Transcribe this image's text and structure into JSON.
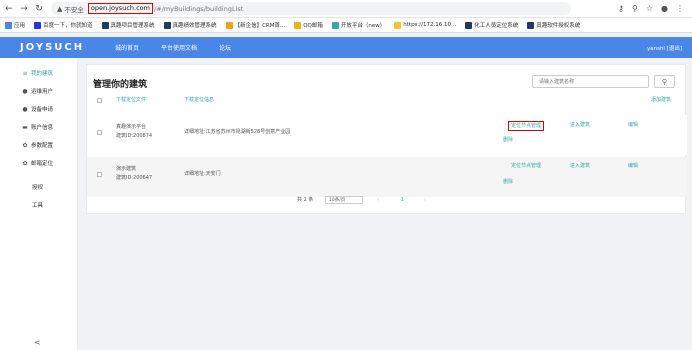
{
  "browser": {
    "insecure_label": "不安全",
    "url_host": "open.joysuch.com",
    "url_path": "/#/myBuildings/buildingList",
    "bookmarks": [
      {
        "label": "应用",
        "color": "#4a86e8"
      },
      {
        "label": "百度一下，你就知道",
        "color": "#2932e1"
      },
      {
        "label": "真趣项目管理系统",
        "color": "#1f3a66"
      },
      {
        "label": "真趣绩效管理系统",
        "color": "#1f3a66"
      },
      {
        "label": "【新企信】CRM首...",
        "color": "#f1a122"
      },
      {
        "label": "QQ邮箱",
        "color": "#e8b21e"
      },
      {
        "label": "开放平台（new）",
        "color": "#3aa6a6"
      },
      {
        "label": "https://172.16.10...",
        "color": "#f3c43b"
      },
      {
        "label": "化工人员定位系统",
        "color": "#1f3a66"
      },
      {
        "label": "真趣软件授权系统",
        "color": "#1f3a66"
      }
    ]
  },
  "header": {
    "logo": "JOYSUCH",
    "nav": [
      "城的首页",
      "平台使用文档",
      "论坛"
    ],
    "user": "yanshi [退出]"
  },
  "sidebar": {
    "items": [
      {
        "label": "我的建筑",
        "icon": "≡",
        "active": true
      },
      {
        "label": "运维用户",
        "icon": "●",
        "active": false
      },
      {
        "label": "设备申请",
        "icon": "●",
        "active": false
      },
      {
        "label": "账户信息",
        "icon": "▬",
        "active": false
      },
      {
        "label": "参数配置",
        "icon": "✿",
        "active": false
      },
      {
        "label": "邮箱定位",
        "icon": "✿",
        "active": false
      }
    ],
    "plain_items": [
      "授权",
      "工具"
    ],
    "collapse": "<"
  },
  "main": {
    "title": "管理你的建筑",
    "search_placeholder": "请输入建筑名称",
    "search_icon": "⚲",
    "header_download": "下载定位文件",
    "header_info": "下载定位信息",
    "add_building": "添加建筑",
    "rows": [
      {
        "name": "真趣演示平台",
        "id": "建筑ID:200874",
        "address": "详细地址:江苏省苏州市昆湖街528号创意产业园",
        "locate": "定位节点管理",
        "enter": "进入建筑",
        "edit": "编辑",
        "delete": "删除"
      },
      {
        "name": "演示建筑",
        "id": "建筑ID:200647",
        "address": "详细地址:天安门",
        "locate": "定位节点管理",
        "enter": "进入建筑",
        "edit": "编辑",
        "delete": "删除"
      }
    ],
    "pager": {
      "total": "共 2 条",
      "per_page": "10条/页",
      "prev": "‹",
      "page": "1",
      "next": "›"
    }
  }
}
